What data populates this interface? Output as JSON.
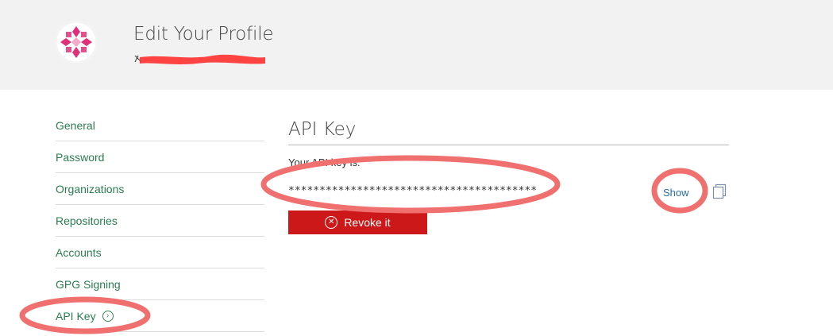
{
  "header": {
    "title": "Edit Your Profile"
  },
  "sidebar": {
    "items": [
      {
        "label": "General"
      },
      {
        "label": "Password"
      },
      {
        "label": "Organizations"
      },
      {
        "label": "Repositories"
      },
      {
        "label": "Accounts"
      },
      {
        "label": "GPG Signing"
      },
      {
        "label": "API Key",
        "active": true
      }
    ]
  },
  "main": {
    "section_title": "API Key",
    "key_label": "Your API key is:",
    "key_value": "****************************************",
    "show_label": "Show",
    "revoke_label": "Revoke it"
  },
  "icons": {
    "avatar": "geometric-logo-icon",
    "copy": "copy-icon",
    "revoke": "circle-x-icon",
    "active_chevron": "chevron-right-circle-icon"
  },
  "colors": {
    "header_bg": "#f2f2f2",
    "nav_link": "#2a7d4f",
    "revoke_bg": "#cc1818",
    "annotation": "#f07070"
  }
}
